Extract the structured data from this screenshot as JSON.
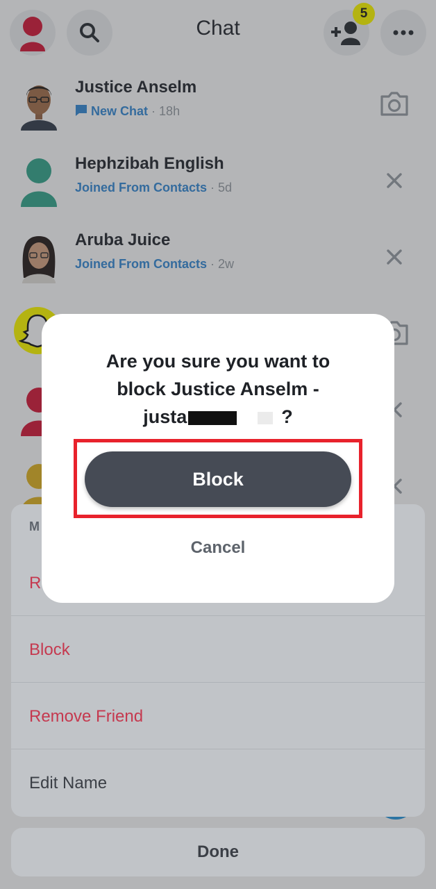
{
  "header": {
    "title": "Chat",
    "friend_requests_badge": "5"
  },
  "chats": [
    {
      "name": "Justice Anselm",
      "status": "New Chat",
      "time": "18h",
      "status_color": "#3b8ed8"
    },
    {
      "name": "Hephzibah English",
      "status": "Joined From Contacts",
      "time": "5d",
      "status_color": "#3b8ed8"
    },
    {
      "name": "Aruba Juice",
      "status": "Joined From Contacts",
      "time": "2w",
      "status_color": "#3b8ed8"
    }
  ],
  "sheet": {
    "header_partial": "M",
    "item_partial": "R",
    "block": "Block",
    "remove_friend": "Remove Friend",
    "edit_name": "Edit Name",
    "done": "Done"
  },
  "modal": {
    "line1": "Are you sure you want to",
    "line2": "block Justice Anselm -",
    "username_visible": "justa",
    "question_mark": "?",
    "block_button": "Block",
    "cancel_button": "Cancel"
  },
  "colors": {
    "destructive": "#c5394f",
    "highlight": "#e8222c",
    "primary_button": "#464b55",
    "snapchat_yellow": "#fffc00"
  }
}
